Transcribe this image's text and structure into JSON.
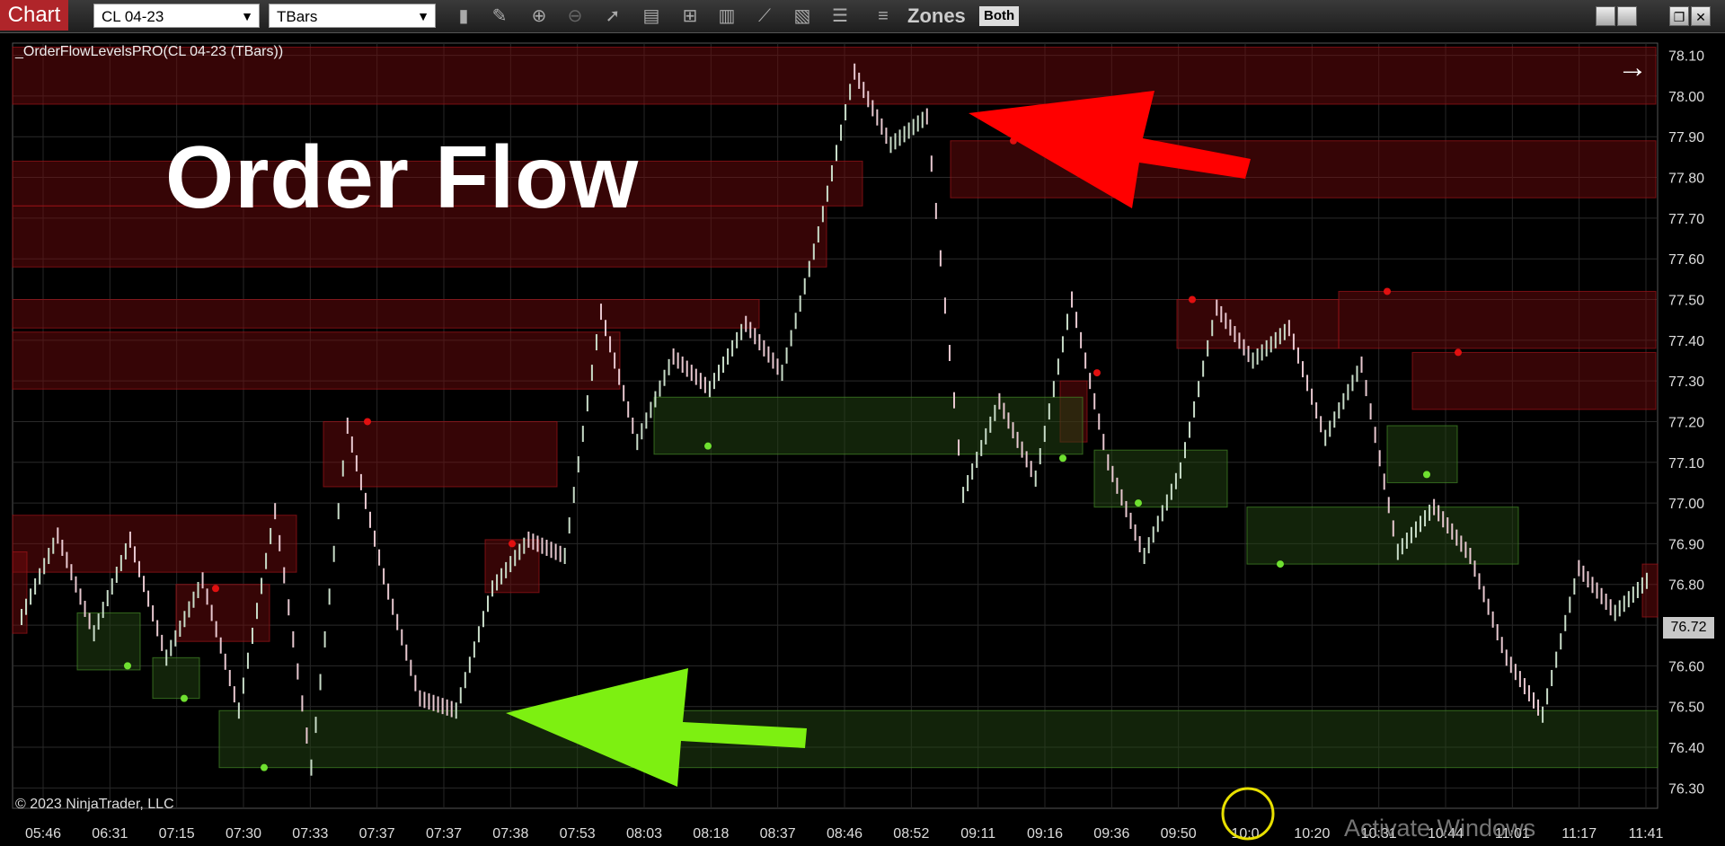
{
  "toolbar": {
    "tab": "Chart",
    "instrument": "CL 04-23",
    "bar_type": "TBars",
    "icons": [
      "bar-style-icon",
      "pencil-icon",
      "zoom-in-icon",
      "zoom-out-icon",
      "pointer-icon",
      "data-box-icon",
      "templates-icon",
      "indicators-icon",
      "strategies-icon",
      "properties-icon",
      "list-icon",
      "sliders-icon"
    ],
    "zones_label": "Zones",
    "zones_mode": "Both",
    "window_buttons": [
      "minimize",
      "restore",
      "maximize",
      "close"
    ]
  },
  "chart": {
    "indicator_label": "_OrderFlowLevelsPRO(CL 04-23 (TBars))",
    "overlay_title": "Order Flow",
    "copyright": "© 2023 NinjaTrader, LLC",
    "watermark": "Activate Windows",
    "current_price": "76.72",
    "nav_arrow": "→"
  },
  "chart_data": {
    "type": "line",
    "y_ticks": [
      "78.10",
      "78.00",
      "77.90",
      "77.80",
      "77.70",
      "77.60",
      "77.50",
      "77.40",
      "77.30",
      "77.20",
      "77.10",
      "77.00",
      "76.90",
      "76.80",
      "76.70",
      "76.60",
      "76.50",
      "76.40",
      "76.30"
    ],
    "x_ticks": [
      "05:46",
      "06:31",
      "07:15",
      "07:30",
      "07:33",
      "07:37",
      "07:37",
      "07:38",
      "07:53",
      "08:03",
      "08:18",
      "08:37",
      "08:46",
      "08:52",
      "09:11",
      "09:16",
      "09:36",
      "09:50",
      "10:0",
      "10:20",
      "10:31",
      "10:44",
      "11:01",
      "11:17",
      "11:41"
    ],
    "ylim": [
      76.25,
      78.13
    ],
    "series": [
      {
        "values": [
          76.72,
          76.92,
          76.68,
          76.91,
          76.62,
          76.81,
          76.49,
          76.98,
          76.35,
          77.19,
          76.82,
          76.52,
          76.49,
          76.79,
          76.91,
          76.87,
          77.47,
          77.15,
          77.36,
          77.28,
          77.44,
          77.32,
          77.66,
          78.06,
          77.88,
          77.95,
          77.02,
          77.25,
          77.06,
          77.5,
          77.1,
          76.87,
          77.08,
          77.48,
          77.35,
          77.43,
          77.16,
          77.34,
          76.88,
          76.99,
          76.87,
          76.62,
          76.48,
          76.84,
          76.73,
          76.82
        ]
      }
    ],
    "supply_zones": [
      [
        78.12,
        77.98
      ],
      [
        77.89,
        77.75
      ],
      [
        77.52,
        77.38
      ],
      [
        77.37,
        77.23
      ],
      [
        77.84,
        77.73
      ],
      [
        77.73,
        77.58
      ],
      [
        77.5,
        77.43
      ],
      [
        77.42,
        77.28
      ],
      [
        77.2,
        77.04
      ],
      [
        76.97,
        76.83
      ],
      [
        76.8,
        76.66
      ],
      [
        76.91,
        76.78
      ],
      [
        77.3,
        77.15
      ],
      [
        77.5,
        77.38
      ],
      [
        76.88,
        76.68
      ],
      [
        76.85,
        76.72
      ]
    ],
    "demand_zones": [
      [
        76.49,
        76.35
      ],
      [
        77.26,
        77.12
      ],
      [
        77.13,
        76.99
      ],
      [
        76.99,
        76.85
      ],
      [
        77.19,
        77.05
      ],
      [
        76.73,
        76.59
      ],
      [
        76.62,
        76.52
      ]
    ],
    "supply_dots": [
      77.89,
      77.2,
      76.9,
      76.79,
      77.32,
      77.5,
      77.52,
      77.37
    ],
    "demand_dots": [
      76.35,
      77.14,
      77.11,
      77.0,
      76.85,
      77.07,
      76.6,
      76.52
    ]
  }
}
